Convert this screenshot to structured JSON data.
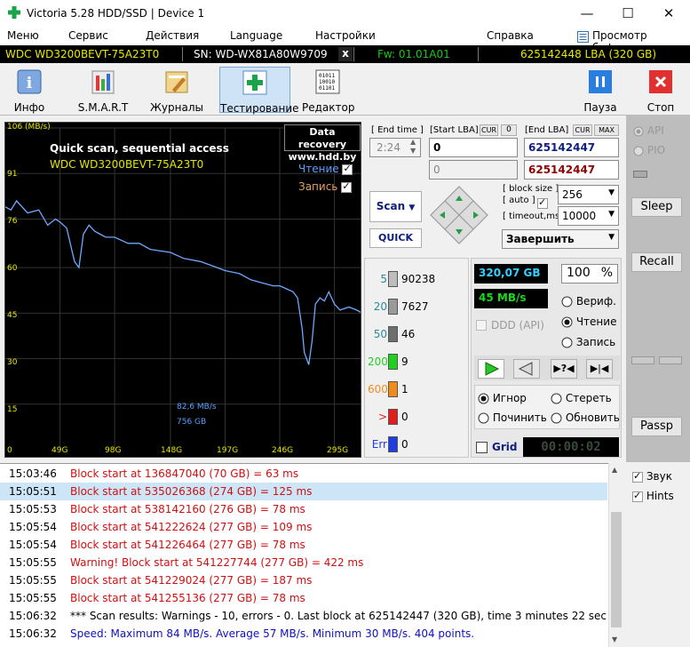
{
  "window": {
    "title": "Victoria 5.28 HDD/SSD | Device 1",
    "controls": [
      "—",
      "☐",
      "✕"
    ]
  },
  "menu": {
    "items": [
      "Меню",
      "Сервис",
      "Действия",
      "Language",
      "Настройки",
      "Справка"
    ],
    "buffer_viewer": "Просмотр буфера"
  },
  "device": {
    "model": "WDC WD3200BEVT-75A23T0",
    "serial": "SN: WD-WX81A80W9709",
    "close": "x",
    "firmware": "Fw: 01.01A01",
    "capacity": "625142448 LBA (320 GB)"
  },
  "toolbar": {
    "info": "Инфо",
    "smart": "S.M.A.R.T",
    "journals": "Журналы",
    "testing": "Тестирование",
    "editor": "Редактор",
    "pause": "Пауза",
    "stop": "Стоп"
  },
  "graph": {
    "unit": "106 (MB/s)",
    "title": "Quick scan, sequential access",
    "device": "WDC WD3200BEVT-75A23T0",
    "data_recovery_1": "Data recovery",
    "data_recovery_2": "www.hdd.by",
    "read_label": "Чтение",
    "write_label": "Запись",
    "speed_readout": "82,6 MB/s",
    "size_readout": "756 GB",
    "y_ticks": [
      "106 (MB/s)",
      "91",
      "76",
      "60",
      "45",
      "30",
      "15",
      "0"
    ],
    "x_ticks": [
      "0",
      "49G",
      "98G",
      "148G",
      "197G",
      "246G",
      "295G"
    ]
  },
  "chart_data": {
    "type": "line",
    "ylabel": "MB/s",
    "ylim": [
      0,
      106
    ],
    "xlim": [
      0,
      320
    ],
    "x_unit": "GB",
    "series": [
      {
        "x": [
          0,
          5,
          10,
          20,
          30,
          38,
          45,
          49,
          55,
          62,
          66,
          70,
          75,
          80,
          85,
          90,
          98,
          110,
          120,
          130,
          148,
          160,
          175,
          190,
          197,
          210,
          220,
          230,
          240,
          246,
          252,
          258,
          262,
          266,
          268,
          270,
          272,
          275,
          278,
          282,
          286,
          290,
          295,
          300,
          308,
          315,
          320
        ],
        "y": [
          80,
          79,
          82,
          78,
          79,
          74,
          76,
          75,
          73,
          62,
          60,
          71,
          74,
          72,
          71,
          70,
          70,
          68,
          68,
          66,
          65,
          63,
          62,
          60,
          59,
          58,
          56,
          55,
          54,
          54,
          53,
          52,
          50,
          40,
          32,
          30,
          28,
          36,
          48,
          50,
          49,
          52,
          48,
          46,
          47,
          46,
          45
        ]
      }
    ]
  },
  "controls": {
    "end_time_label": "[ End time ]",
    "end_time_value": "2:24",
    "start_lba_label": "[Start LBA]",
    "cur_label": "CUR",
    "zero_label": "0",
    "start_lba_value": "0",
    "start_lba_current": "0",
    "end_lba_label": "[End LBA]",
    "max_label": "MAX",
    "end_lba_value": "625142447",
    "end_lba_current": "625142447",
    "scan_button": "Scan",
    "quick_button": "QUICK",
    "block_size_label": "[ block size ]",
    "auto_label": "[ auto ]",
    "timeout_label": "[ timeout,ms ]",
    "block_size_value": "256",
    "timeout_value": "10000",
    "action_select": "Завершить"
  },
  "stats": {
    "buckets": [
      {
        "label": "5",
        "count": "90238",
        "color": "#bdbdbd"
      },
      {
        "label": "20",
        "count": "7627",
        "color": "#9a9a9a"
      },
      {
        "label": "50",
        "count": "46",
        "color": "#6e6e6e"
      },
      {
        "label": "200",
        "count": "9",
        "color": "#1fd01f"
      },
      {
        "label": "600",
        "count": "1",
        "color": "#f08c1e"
      },
      {
        "label": ">",
        "count": "0",
        "color": "#e01e1e"
      },
      {
        "label": "Err",
        "count": "0",
        "color": "#1e3ce0"
      }
    ],
    "scanned_gb": "320,07 GB",
    "percent": "100",
    "percent_sign": "%",
    "speed": "45 MB/s",
    "ddd_label": "DDD (API)",
    "verify": "Вериф.",
    "read": "Чтение",
    "write": "Запись",
    "ignore": "Игнор",
    "erase": "Стереть",
    "repair": "Починить",
    "update": "Обновить",
    "grid": "Grid",
    "timer": "00:00:02"
  },
  "side": {
    "api": "API",
    "pio": "PIO",
    "sleep": "Sleep",
    "recall": "Recall",
    "passp": "Passp",
    "sound": "Звук",
    "hints": "Hints"
  },
  "log": [
    {
      "time": "15:03:46",
      "msg": "Block start at 136847040 (70 GB)  = 63 ms",
      "color": "#d01010"
    },
    {
      "time": "15:05:51",
      "msg": "Block start at 535026368 (274 GB)  = 125 ms",
      "color": "#d01010"
    },
    {
      "time": "15:05:53",
      "msg": "Block start at 538142160 (276 GB)  = 78 ms",
      "color": "#d01010"
    },
    {
      "time": "15:05:54",
      "msg": "Block start at 541222624 (277 GB)  = 109 ms",
      "color": "#d01010"
    },
    {
      "time": "15:05:54",
      "msg": "Block start at 541226464 (277 GB)  = 78 ms",
      "color": "#d01010"
    },
    {
      "time": "15:05:55",
      "msg": "Warning! Block start at 541227744 (277 GB)  = 422 ms",
      "color": "#d01010"
    },
    {
      "time": "15:05:55",
      "msg": "Block start at 541229024 (277 GB)  = 187 ms",
      "color": "#d01010"
    },
    {
      "time": "15:05:55",
      "msg": "Block start at 541255136 (277 GB)  = 78 ms",
      "color": "#d01010"
    },
    {
      "time": "15:06:32",
      "msg": "*** Scan results: Warnings - 10, errors - 0. Last block at 625142447 (320 GB), time 3 minutes 22 sec...",
      "color": "#000000"
    },
    {
      "time": "15:06:32",
      "msg": "Speed: Maximum 84 MB/s. Average 57 MB/s. Minimum 30 MB/s. 404 points.",
      "color": "#1010c0"
    }
  ]
}
